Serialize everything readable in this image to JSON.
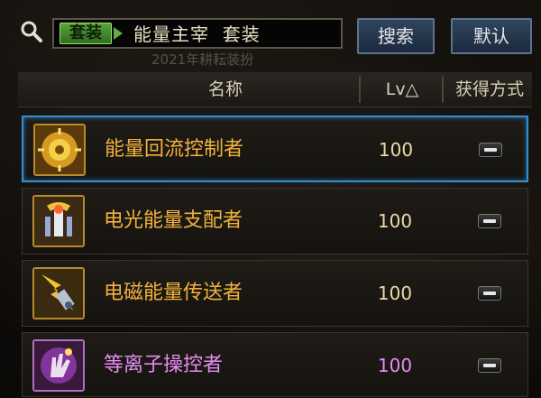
{
  "search": {
    "tag": "套装",
    "query": "能量主宰  套装",
    "search_button": "搜索",
    "default_button": "默认"
  },
  "background_text": "2021年耕耘装扮",
  "header": {
    "name": "名称",
    "level": "Lv△",
    "acquire": "获得方式"
  },
  "items": [
    {
      "name": "能量回流控制者",
      "level": "100",
      "rarity": "legendary",
      "icon": "golden-mechanism-icon"
    },
    {
      "name": "电光能量支配者",
      "level": "100",
      "rarity": "legendary",
      "icon": "lightning-totem-icon"
    },
    {
      "name": "电磁能量传送者",
      "level": "100",
      "rarity": "legendary",
      "icon": "electromagnetic-device-icon"
    },
    {
      "name": "等离子操控者",
      "level": "100",
      "rarity": "epic",
      "icon": "plasma-glove-icon"
    }
  ],
  "colors": {
    "legendary_text": "#f2b23c",
    "epic_text": "#e58cf0",
    "selection_border": "#2f90d8"
  }
}
